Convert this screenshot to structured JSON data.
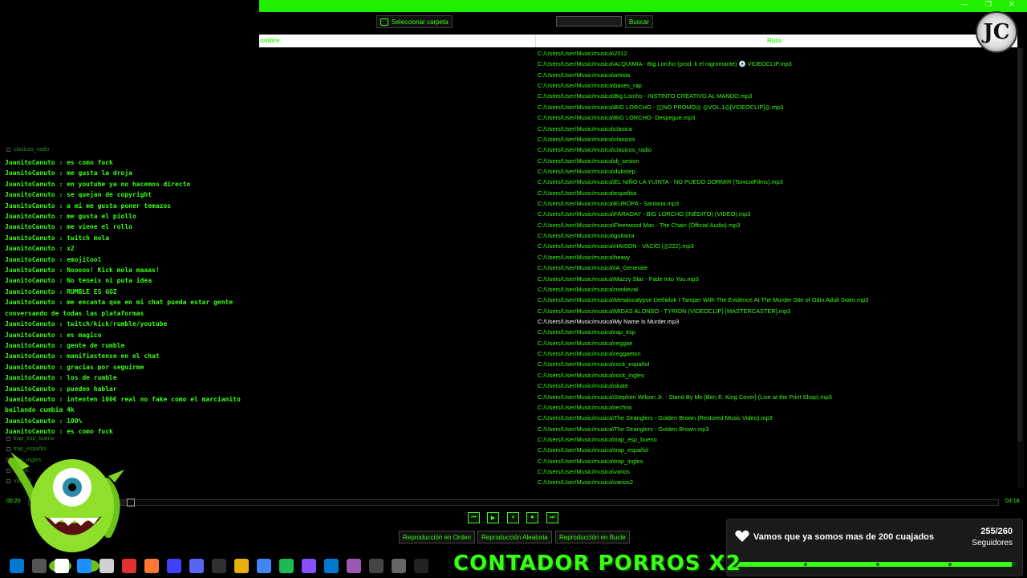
{
  "window": {
    "controls": [
      "—",
      "❐",
      "✕"
    ]
  },
  "toolbar": {
    "select_folder_label": "Seleccionar carpeta",
    "search_placeholder": "",
    "search_label": "Buscar"
  },
  "table": {
    "col_name": "ombre",
    "col_path": "Ruta",
    "rows": [
      "C:/Users/User/Music/musica\\2012",
      "C:/Users/User/Music/musica\\ALQUIMIA - Big Lorcho (prod. k el nigromante) 💿 VIDEOCLIP.mp3",
      "C:/Users/User/Music/musica\\artista",
      "C:/Users/User/Music/musica\\bases_rap",
      "C:/Users/User/Music/musica\\Big Lorcho - INSTINTO CREATIVO AL MANDO.mp3",
      "C:/Users/User/Music/musica\\BIG LORCHO - ▯▯NO PROMO◎ ◎VOL.1◎[VIDEOCLIP]◎.mp3",
      "C:/Users/User/Music/musica\\BIG LORCHO- Despegue.mp3",
      "C:/Users/User/Music/musica\\clasica",
      "C:/Users/User/Music/musica\\clasicos",
      "C:/Users/User/Music/musica\\clasicos_radio",
      "C:/Users/User/Music/musica\\dj_sesion",
      "C:/Users/User/Music/musica\\dubstep",
      "C:/Users/User/Music/musica\\EL NIÑO LA YUINTA - NO PUEDO DORMIR (TonicotFilms).mp3",
      "C:/Users/User/Music/musica\\españita",
      "C:/Users/User/Music/musica\\EUROPA - Santana.mp3",
      "C:/Users/User/Music/musica\\FARADAY - BIG LORCHO  (INÉDITO) (VIDEO).mp3",
      "C:/Users/User/Music/musica\\Fleetwood Mac - The Chain (Official Audio).mp3",
      "C:/Users/User/Music/musica\\guitarra",
      "C:/Users/User/Music/musica\\HAISON - VACÍO  (◎222).mp3",
      "C:/Users/User/Music/musica\\heavy",
      "C:/Users/User/Music/musica\\IA_Generate",
      "C:/Users/User/Music/musica\\Mazzy Star -  Fade Into You.mp3",
      "C:/Users/User/Music/musica\\medieval",
      "C:/Users/User/Music/musica\\Metalocalypse Dethklok  I Tamper With The Evidence At The Murder Site of Odin  Adult Swim.mp3",
      "C:/Users/User/Music/musica\\MIDAS ALONSO - TYRION (VIDEOCLIP) [MASTERCASTER].mp3",
      "C:/Users/User/Music/musica\\My Name Is Murder.mp3",
      "C:/Users/User/Music/musica\\rap_esp",
      "C:/Users/User/Music/musica\\reggae",
      "C:/Users/User/Music/musica\\reggaeton",
      "C:/Users/User/Music/musica\\rock_español",
      "C:/Users/User/Music/musica\\rock_ingles",
      "C:/Users/User/Music/musica\\skate",
      "C:/Users/User/Music/musica\\Stephen Wilson Jr. - Stand By Me [Ben E. King Cover] (Live at the Print Shop).mp3",
      "C:/Users/User/Music/musica\\techno",
      "C:/Users/User/Music/musica\\The Stranglers - Golden Brown (Restored Music Video).mp3",
      "C:/Users/User/Music/musica\\The Stranglers - Golden Brown.mp3",
      "C:/Users/User/Music/musica\\trap_esp_bueno",
      "C:/Users/User/Music/musica\\trap_español",
      "C:/Users/User/Music/musica\\trap_ingles",
      "C:/Users/User/Music/musica\\varios",
      "C:/Users/User/Music/musica\\varios2"
    ],
    "selected_row": 25
  },
  "tree": {
    "items": [
      "clasicos_radio",
      "trap_esp_bueno",
      "trap_español",
      "trap_ingles",
      "varios",
      "varios2"
    ]
  },
  "chat": {
    "messages": [
      {
        "user": "JuanitoCanuto",
        "text": "es como fuck"
      },
      {
        "user": "JuanitoCanuto",
        "text": "me gusta la droja"
      },
      {
        "user": "JuanitoCanuto",
        "text": "en youtube ya no hacemos directo"
      },
      {
        "user": "JuanitoCanuto",
        "text": "se quejan de copyright"
      },
      {
        "user": "JuanitoCanuto",
        "text": "a mi me gusta poner temazos"
      },
      {
        "user": "JuanitoCanuto",
        "text": "me gusta el piollo"
      },
      {
        "user": "JuanitoCanuto",
        "text": "me viene el rollo"
      },
      {
        "user": "JuanitoCanuto",
        "text": "twitch mola"
      },
      {
        "user": "JuanitoCanuto",
        "text": "x2"
      },
      {
        "user": "JuanitoCanuto",
        "text": "emojiCool"
      },
      {
        "user": "JuanitoCanuto",
        "text": "Nooooo! Kick mola maaas!"
      },
      {
        "user": "JuanitoCanuto",
        "text": "No teneis ni puta idea"
      },
      {
        "user": "JuanitoCanuto",
        "text": "RUMBLE ES GOZ"
      },
      {
        "user": "JuanitoCanuto",
        "text": "me encanta que en mi chat pueda estar gente conversando de todas las plataformas"
      },
      {
        "user": "JuanitoCanuto",
        "text": "twitch/kick/rumble/youtube"
      },
      {
        "user": "JuanitoCanuto",
        "text": "es magico"
      },
      {
        "user": "JuanitoCanuto",
        "text": "gente de rumble"
      },
      {
        "user": "JuanitoCanuto",
        "text": "manifiestense en el chat"
      },
      {
        "user": "JuanitoCanuto",
        "text": "gracias por seguirme"
      },
      {
        "user": "JuanitoCanuto",
        "text": "los de rumble"
      },
      {
        "user": "JuanitoCanuto",
        "text": "pueden hablar"
      },
      {
        "user": "JuanitoCanuto",
        "text": "intenten 100€ real no fake como el marcianito bailando cumbia 4k"
      },
      {
        "user": "JuanitoCanuto",
        "text": "100%"
      },
      {
        "user": "JuanitoCanuto",
        "text": "es como fuck"
      }
    ]
  },
  "player": {
    "elapsed": "00:20",
    "total": "03:18",
    "progress": 0.101,
    "controls": [
      "⏮",
      "▶",
      "⏸",
      "⏹",
      "⏭"
    ],
    "mode_order": "Reproducción en Orden",
    "mode_random": "Reproducción Aleatoria",
    "mode_loop": "Reproducción en Bucle"
  },
  "overlay": {
    "logo_letter": "JC",
    "goal_title": "Vamos que ya somos mas de 200 cuajados",
    "goal_count": "255/260",
    "goal_label": "Seguidores",
    "goal_progress": 0.98,
    "counter_text": "CONTADOR PORROS X2"
  },
  "taskbar": {
    "icons": [
      "windows-icon",
      "search-icon",
      "cursor-icon",
      "folder-icon",
      "edge-icon",
      "notepad-icon",
      "jetbrains-icon",
      "git-icon",
      "v-icon",
      "discord-icon",
      "obs-icon",
      "files-icon",
      "chrome-icon",
      "spotify-icon",
      "vs-icon",
      "vscode-icon",
      "visual-studio-icon",
      "terminal-icon",
      "unity-icon"
    ],
    "colors": [
      "#0078d4",
      "#555555",
      "#ffffff",
      "#1e90ff",
      "#d0d0d0",
      "#e03030",
      "#ff7733",
      "#4040ff",
      "#5865f2",
      "#303030",
      "#e8b00a",
      "#4285f4",
      "#1db954",
      "#8a4fff",
      "#007acc",
      "#9b59b6",
      "#444444",
      "#666666",
      "#222222"
    ]
  }
}
